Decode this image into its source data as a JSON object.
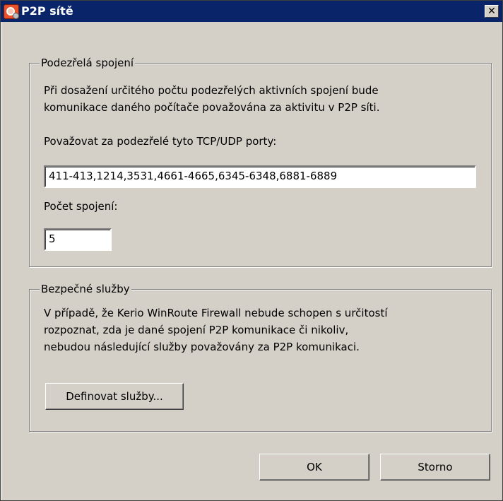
{
  "window": {
    "title": "P2P sítě"
  },
  "suspicious": {
    "legend": "Podezřelá spojení",
    "desc_line1": "Při dosažení určitého počtu podezřelých aktivních spojení bude",
    "desc_line2": "komunikace daného počítače považována za aktivitu v P2P síti.",
    "ports_label": "Považovat za podezřelé tyto TCP/UDP porty:",
    "ports_value": "411-413,1214,3531,4661-4665,6345-6348,6881-6889",
    "count_label": "Počet spojení:",
    "count_value": "5"
  },
  "safe": {
    "legend": "Bezpečné služby",
    "desc_line1": "V případě, že Kerio WinRoute Firewall nebude schopen s určitostí",
    "desc_line2": "rozpoznat, zda je dané spojení P2P komunikace či nikoliv,",
    "desc_line3": "nebudou následující služby považovány za P2P komunikaci.",
    "define_button": "Definovat služby..."
  },
  "buttons": {
    "ok": "OK",
    "cancel": "Storno"
  }
}
